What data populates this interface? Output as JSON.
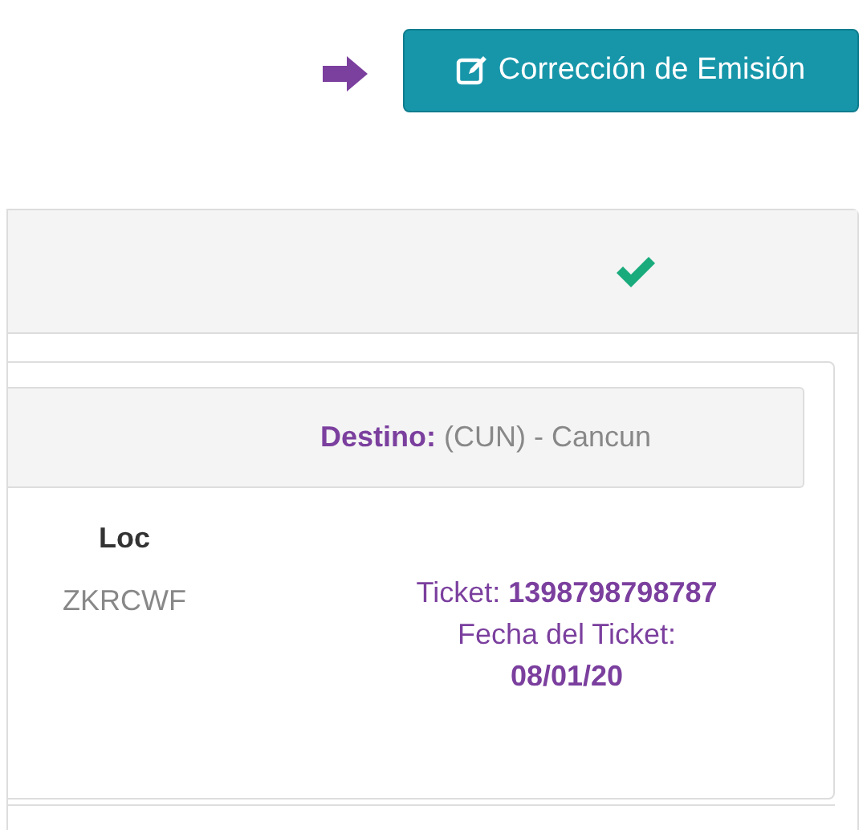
{
  "toolbar": {
    "button": {
      "label": "Corrección de Emisión"
    }
  },
  "panel": {
    "status": {
      "kind": "ok"
    },
    "card": {
      "destination": {
        "label": "Destino:",
        "value": "(CUN) - Cancun"
      },
      "loc": {
        "heading": "Loc",
        "value": "ZKRCWF"
      },
      "ticket": {
        "line": "Ticket: **1398798798787**",
        "date_label": "Fecha del Ticket:",
        "date": "08/01/20"
      }
    }
  }
}
